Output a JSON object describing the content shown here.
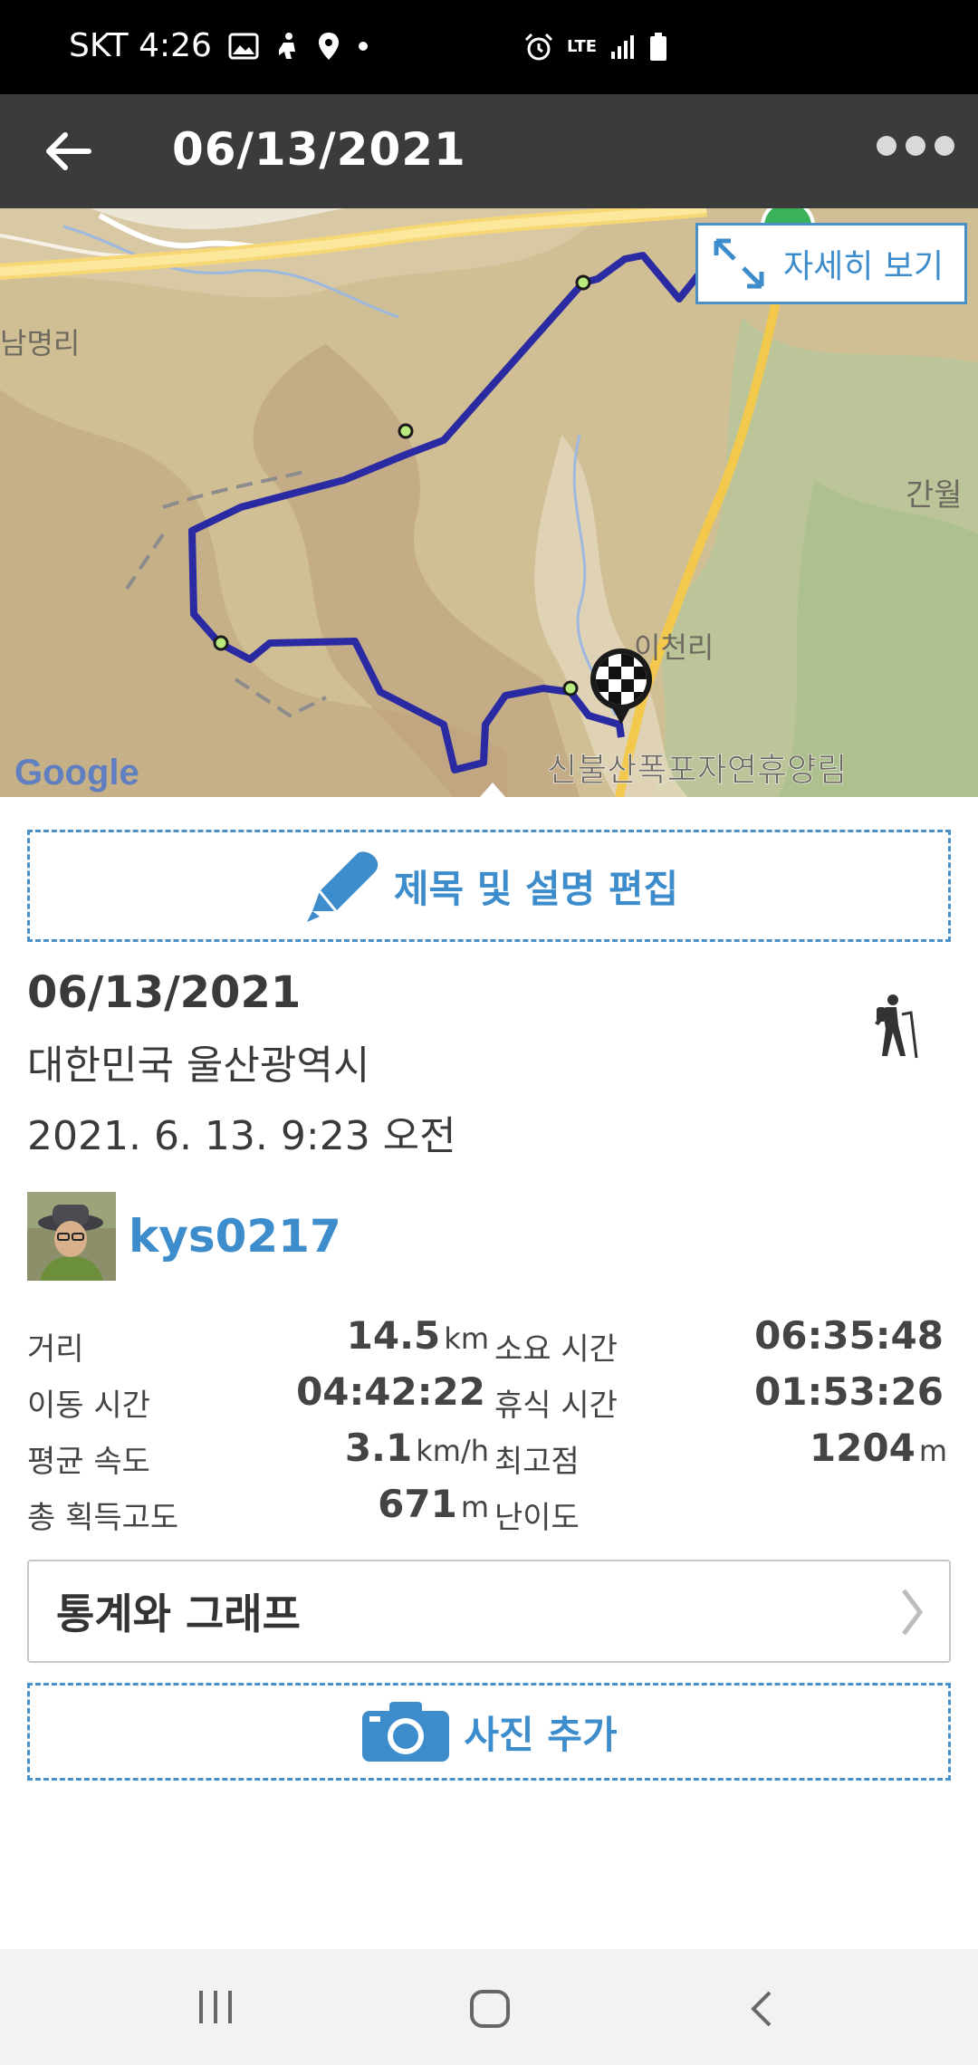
{
  "status_bar": {
    "carrier_time": "SKT 4:26",
    "left_icons": [
      "gallery-icon",
      "hiker-notification-icon",
      "location-icon",
      "dot-icon"
    ],
    "network": "LTE",
    "right_icons": [
      "alarm-icon",
      "lte-icon",
      "signal-icon",
      "battery-icon"
    ]
  },
  "app_bar": {
    "title": "06/13/2021",
    "back_icon": "arrow-left-icon",
    "menu_icon": "more-horizontal-icon"
  },
  "map": {
    "detail_button_label": "자세히 보기",
    "place_labels": [
      "남명리",
      "간월",
      "이천리",
      "신불산폭포자연휴양림"
    ],
    "attribution": "Google",
    "route_color": "#2a2aa3"
  },
  "edit": {
    "label": "제목 및 설명 편집",
    "icon": "pencil-icon"
  },
  "activity": {
    "date": "06/13/2021",
    "location": "대한민국 울산광역시",
    "datetime": "2021. 6. 13. 9:23 오전",
    "type_icon": "hiking-icon"
  },
  "user": {
    "name": "kys0217"
  },
  "stats": [
    {
      "label1": "거리",
      "value1": "14.5",
      "unit1": "km",
      "label2": "소요 시간",
      "value2": "06:35:48",
      "unit2": ""
    },
    {
      "label1": "이동 시간",
      "value1": "04:42:22",
      "unit1": "",
      "label2": "휴식 시간",
      "value2": "01:53:26",
      "unit2": ""
    },
    {
      "label1": "평균 속도",
      "value1": "3.1",
      "unit1": "km/h",
      "label2": "최고점",
      "value2": "1204",
      "unit2": "m"
    },
    {
      "label1": "총 획득고도",
      "value1": "671",
      "unit1": "m",
      "label2": "난이도",
      "value2": "",
      "unit2": ""
    }
  ],
  "stats_graph_button": {
    "label": "통계와 그래프"
  },
  "photo": {
    "label": "사진 추가",
    "icon": "camera-icon"
  },
  "colors": {
    "accent": "#3d8ccc",
    "app_bar": "#3b3b3b",
    "route": "#2a2aa3"
  }
}
